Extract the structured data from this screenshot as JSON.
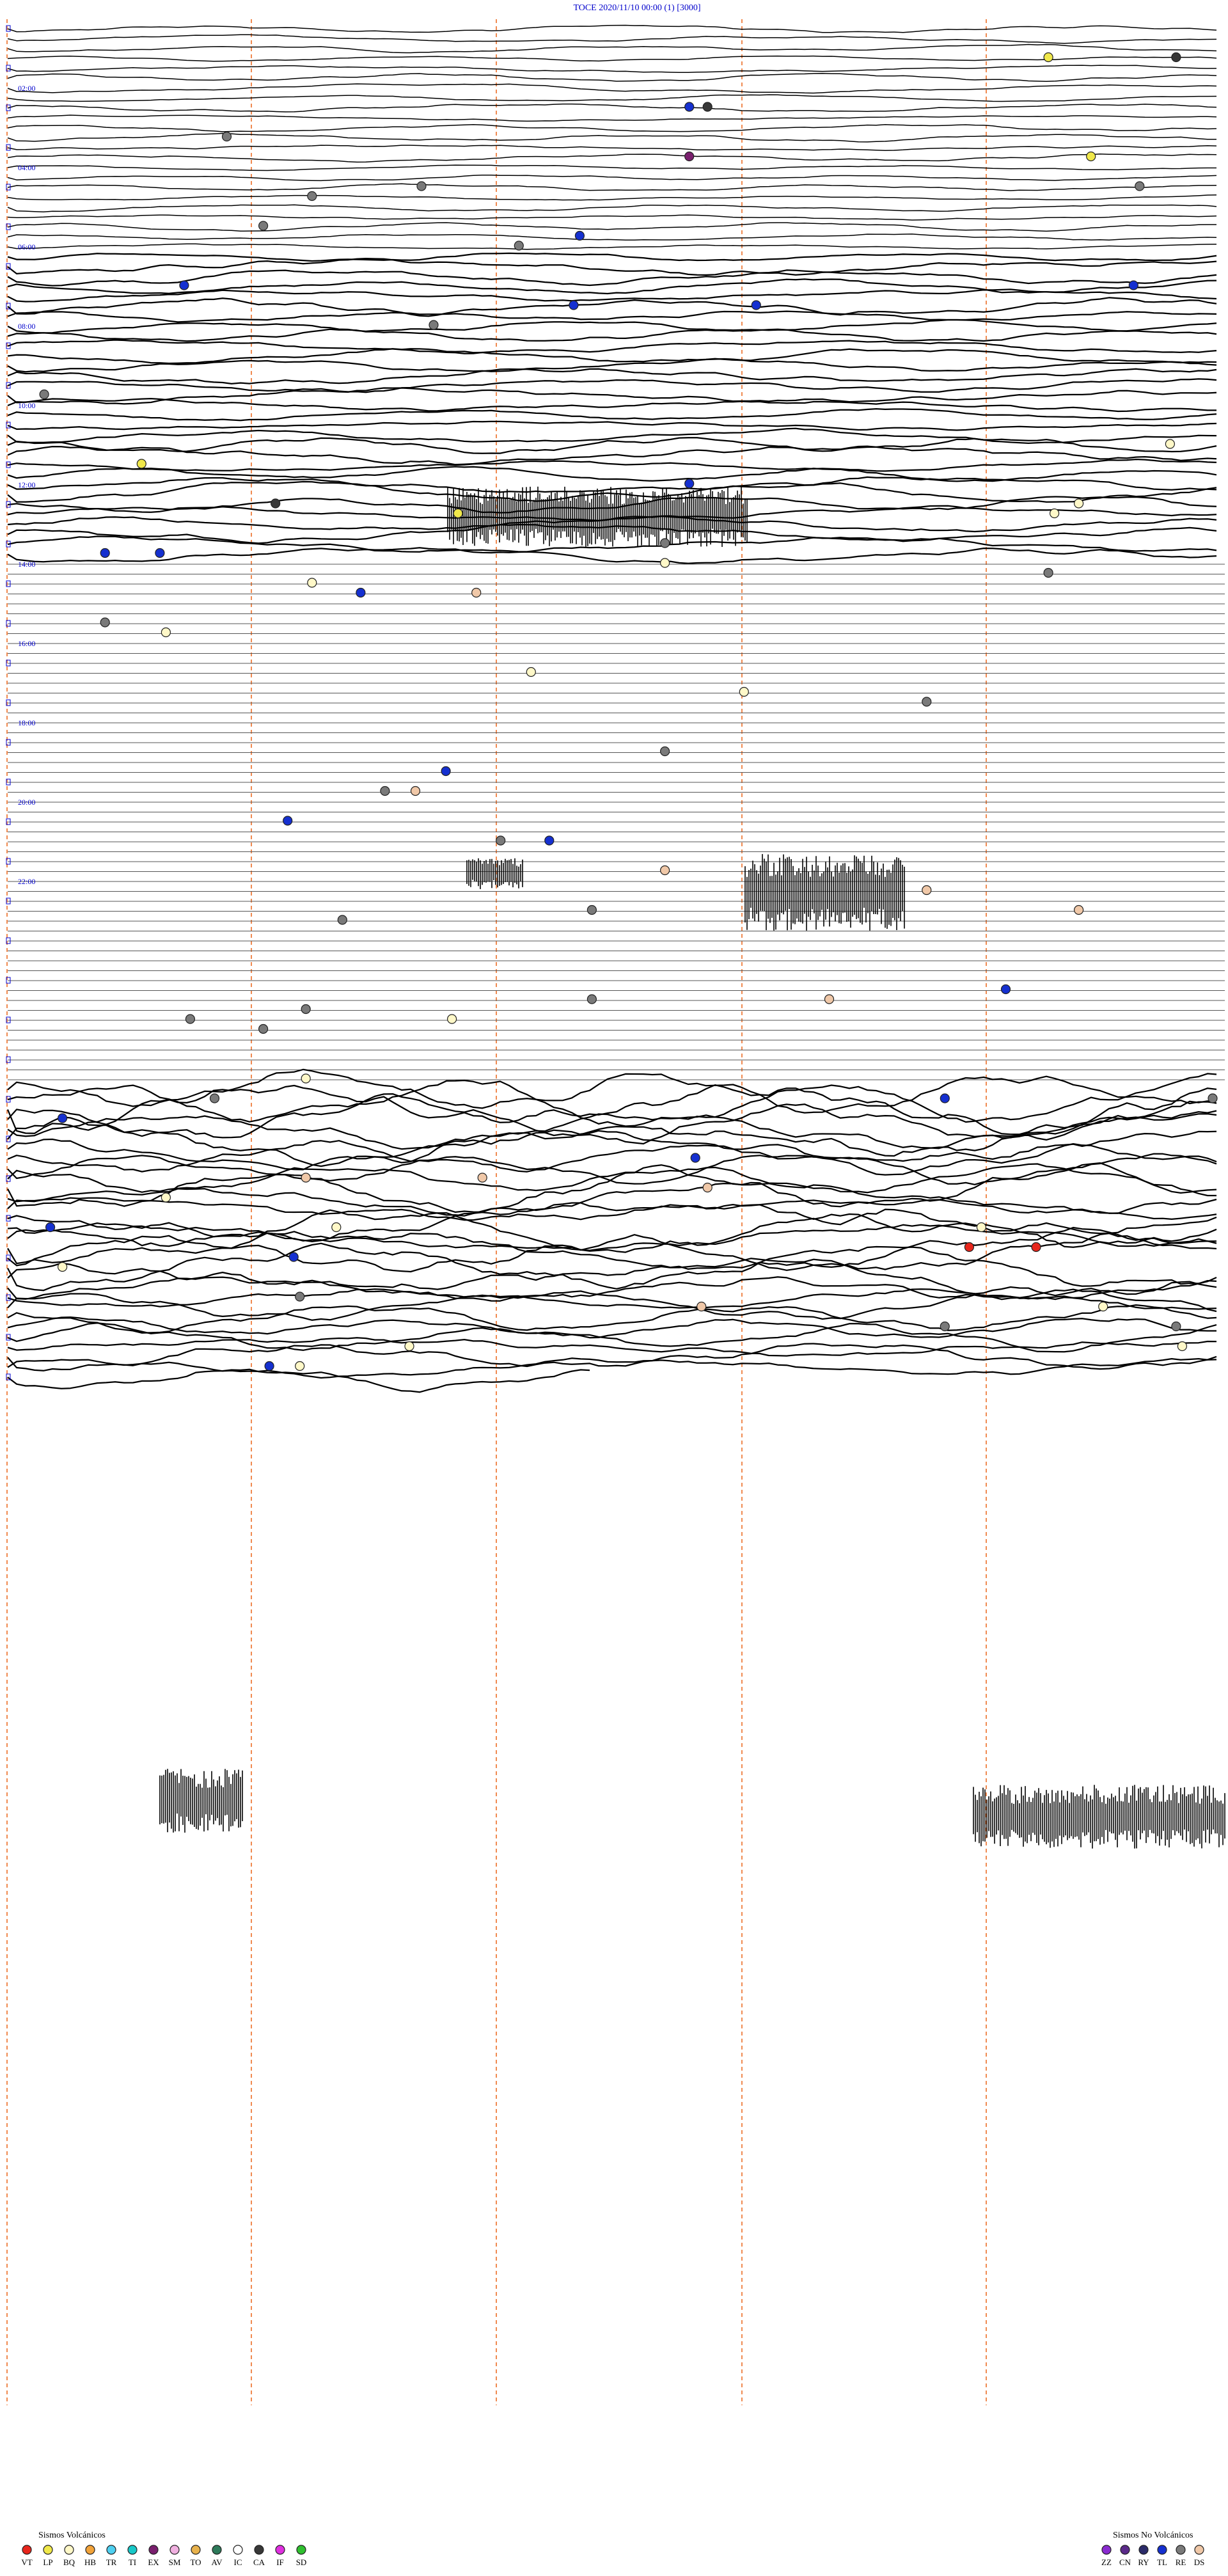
{
  "chart_data": {
    "type": "line",
    "title": "TOCE    2020/11/10 00:00     (1)   [3000]",
    "hour_labels": [
      "02:00",
      "04:00",
      "06:00",
      "08:00",
      "10:00",
      "12:00",
      "14:00",
      "16:00",
      "18:00",
      "20:00",
      "22:00"
    ],
    "legend_volcanic": {
      "title": "Sismos Volcánicos",
      "items": [
        {
          "code": "VT",
          "color": "#e8261c"
        },
        {
          "code": "LP",
          "color": "#f0e84a"
        },
        {
          "code": "BQ",
          "color": "#fff8c8"
        },
        {
          "code": "HB",
          "color": "#f2a33a"
        },
        {
          "code": "TR",
          "color": "#4fd0f0"
        },
        {
          "code": "TI",
          "color": "#18c8c8"
        },
        {
          "code": "EX",
          "color": "#7a1f6e"
        },
        {
          "code": "SM",
          "color": "#f0b0e0"
        },
        {
          "code": "TO",
          "color": "#e8b24c"
        },
        {
          "code": "AV",
          "color": "#2e7a5a"
        },
        {
          "code": "IC",
          "color": "#ffffff"
        },
        {
          "code": "CA",
          "color": "#383838"
        },
        {
          "code": "IF",
          "color": "#e030e0"
        },
        {
          "code": "SD",
          "color": "#30c030"
        }
      ]
    },
    "legend_nonvolcanic": {
      "title": "Sismos No Volcánicos",
      "items": [
        {
          "code": "ZZ",
          "color": "#8a2bd0"
        },
        {
          "code": "CN",
          "color": "#5b2a8a"
        },
        {
          "code": "RY",
          "color": "#2c2c6a"
        },
        {
          "code": "TL",
          "color": "#1530d0"
        },
        {
          "code": "RE",
          "color": "#7a7a7a"
        },
        {
          "code": "DS",
          "color": "#f0c8a8"
        }
      ]
    },
    "events": [
      {
        "row": 3,
        "x": 0.855,
        "type": "LP"
      },
      {
        "row": 3,
        "x": 0.96,
        "type": "CA"
      },
      {
        "row": 8,
        "x": 0.56,
        "type": "TL"
      },
      {
        "row": 8,
        "x": 0.575,
        "type": "CA"
      },
      {
        "row": 11,
        "x": 0.18,
        "type": "RE"
      },
      {
        "row": 13,
        "x": 0.56,
        "type": "EX"
      },
      {
        "row": 13,
        "x": 0.89,
        "type": "LP"
      },
      {
        "row": 16,
        "x": 0.34,
        "type": "RE"
      },
      {
        "row": 16,
        "x": 0.93,
        "type": "RE"
      },
      {
        "row": 17,
        "x": 0.25,
        "type": "RE"
      },
      {
        "row": 20,
        "x": 0.21,
        "type": "RE"
      },
      {
        "row": 21,
        "x": 0.47,
        "type": "TL"
      },
      {
        "row": 22,
        "x": 0.42,
        "type": "RE"
      },
      {
        "row": 26,
        "x": 0.145,
        "type": "TL"
      },
      {
        "row": 26,
        "x": 0.925,
        "type": "TL"
      },
      {
        "row": 28,
        "x": 0.465,
        "type": "TL"
      },
      {
        "row": 28,
        "x": 0.615,
        "type": "TL"
      },
      {
        "row": 30,
        "x": 0.35,
        "type": "RE"
      },
      {
        "row": 37,
        "x": 0.03,
        "type": "RE"
      },
      {
        "row": 42,
        "x": 0.955,
        "type": "BQ"
      },
      {
        "row": 44,
        "x": 0.11,
        "type": "LP"
      },
      {
        "row": 46,
        "x": 0.56,
        "type": "TL"
      },
      {
        "row": 48,
        "x": 0.22,
        "type": "CA"
      },
      {
        "row": 48,
        "x": 0.88,
        "type": "BQ"
      },
      {
        "row": 49,
        "x": 0.86,
        "type": "BQ"
      },
      {
        "row": 49,
        "x": 0.37,
        "type": "LP"
      },
      {
        "row": 52,
        "x": 0.54,
        "type": "RE"
      },
      {
        "row": 53,
        "x": 0.08,
        "type": "TL"
      },
      {
        "row": 53,
        "x": 0.125,
        "type": "TL"
      },
      {
        "row": 54,
        "x": 0.54,
        "type": "BQ"
      },
      {
        "row": 55,
        "x": 0.855,
        "type": "RE"
      },
      {
        "row": 56,
        "x": 0.25,
        "type": "BQ"
      },
      {
        "row": 57,
        "x": 0.29,
        "type": "TL"
      },
      {
        "row": 57,
        "x": 0.385,
        "type": "DS"
      },
      {
        "row": 60,
        "x": 0.08,
        "type": "RE"
      },
      {
        "row": 61,
        "x": 0.13,
        "type": "BQ"
      },
      {
        "row": 65,
        "x": 0.43,
        "type": "BQ"
      },
      {
        "row": 67,
        "x": 0.605,
        "type": "BQ"
      },
      {
        "row": 68,
        "x": 0.755,
        "type": "RE"
      },
      {
        "row": 73,
        "x": 0.54,
        "type": "RE"
      },
      {
        "row": 75,
        "x": 0.36,
        "type": "TL"
      },
      {
        "row": 77,
        "x": 0.31,
        "type": "RE"
      },
      {
        "row": 77,
        "x": 0.335,
        "type": "DS"
      },
      {
        "row": 80,
        "x": 0.23,
        "type": "TL"
      },
      {
        "row": 82,
        "x": 0.405,
        "type": "RE"
      },
      {
        "row": 82,
        "x": 0.445,
        "type": "TL"
      },
      {
        "row": 85,
        "x": 0.54,
        "type": "DS"
      },
      {
        "row": 87,
        "x": 0.755,
        "type": "DS"
      },
      {
        "row": 89,
        "x": 0.48,
        "type": "RE"
      },
      {
        "row": 89,
        "x": 0.88,
        "type": "DS"
      },
      {
        "row": 90,
        "x": 0.275,
        "type": "RE"
      },
      {
        "row": 97,
        "x": 0.82,
        "type": "TL"
      },
      {
        "row": 98,
        "x": 0.675,
        "type": "DS"
      },
      {
        "row": 98,
        "x": 0.48,
        "type": "RE"
      },
      {
        "row": 99,
        "x": 0.245,
        "type": "RE"
      },
      {
        "row": 100,
        "x": 0.15,
        "type": "RE"
      },
      {
        "row": 100,
        "x": 0.365,
        "type": "BQ"
      },
      {
        "row": 101,
        "x": 0.21,
        "type": "RE"
      },
      {
        "row": 106,
        "x": 0.245,
        "type": "BQ"
      },
      {
        "row": 108,
        "x": 0.17,
        "type": "RE"
      },
      {
        "row": 108,
        "x": 0.77,
        "type": "TL"
      },
      {
        "row": 108,
        "x": 0.99,
        "type": "RE"
      },
      {
        "row": 110,
        "x": 0.045,
        "type": "TL"
      },
      {
        "row": 114,
        "x": 0.565,
        "type": "TL"
      },
      {
        "row": 116,
        "x": 0.245,
        "type": "DS"
      },
      {
        "row": 116,
        "x": 0.39,
        "type": "DS"
      },
      {
        "row": 117,
        "x": 0.575,
        "type": "DS"
      },
      {
        "row": 118,
        "x": 0.13,
        "type": "BQ"
      },
      {
        "row": 121,
        "x": 0.035,
        "type": "TL"
      },
      {
        "row": 121,
        "x": 0.27,
        "type": "BQ"
      },
      {
        "row": 121,
        "x": 0.8,
        "type": "BQ"
      },
      {
        "row": 123,
        "x": 0.79,
        "type": "VT"
      },
      {
        "row": 123,
        "x": 0.845,
        "type": "VT"
      },
      {
        "row": 124,
        "x": 0.235,
        "type": "TL"
      },
      {
        "row": 125,
        "x": 0.045,
        "type": "BQ"
      },
      {
        "row": 128,
        "x": 0.24,
        "type": "RE"
      },
      {
        "row": 129,
        "x": 0.57,
        "type": "DS"
      },
      {
        "row": 129,
        "x": 0.9,
        "type": "BQ"
      },
      {
        "row": 131,
        "x": 0.77,
        "type": "RE"
      },
      {
        "row": 131,
        "x": 0.96,
        "type": "RE"
      },
      {
        "row": 133,
        "x": 0.33,
        "type": "BQ"
      },
      {
        "row": 133,
        "x": 0.965,
        "type": "BQ"
      },
      {
        "row": 135,
        "x": 0.215,
        "type": "TL"
      },
      {
        "row": 135,
        "x": 0.24,
        "type": "BQ"
      }
    ]
  }
}
